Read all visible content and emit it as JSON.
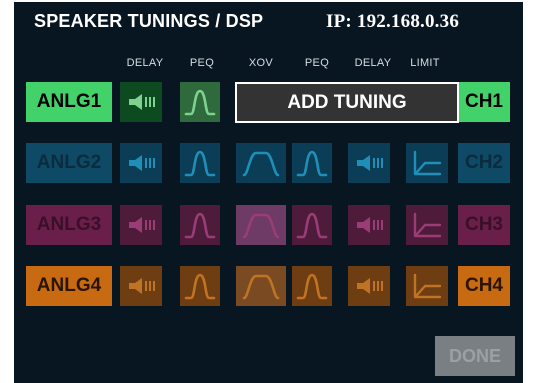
{
  "header": {
    "title": "SPEAKER TUNINGS / DSP",
    "ip_label": "IP: 192.168.0.36"
  },
  "columns": [
    "DELAY",
    "PEQ",
    "XOV",
    "PEQ",
    "DELAY",
    "LIMIT"
  ],
  "icons": {
    "delay": "speaker-delay-icon",
    "peq": "peq-bell-icon",
    "xov": "crossover-icon",
    "limit": "limiter-icon"
  },
  "add_tuning_label": "ADD TUNING",
  "done_label": "DONE",
  "rows": [
    {
      "input": "ANLG1",
      "output": "CH1",
      "colors": {
        "label": "#43d16a",
        "cell": "#0e4a1f",
        "glyph": "#7fd18e",
        "text": "#000000"
      }
    },
    {
      "input": "ANLG2",
      "output": "CH2",
      "colors": {
        "label": "#0e4a66",
        "cell": "#0b3d56",
        "glyph": "#1f8fb8",
        "text": "#0a2c3e"
      }
    },
    {
      "input": "ANLG3",
      "output": "CH3",
      "colors": {
        "label": "#6a1f4a",
        "cell": "#4e1b3a",
        "glyph": "#9a3d77",
        "text": "#3a0f2a"
      }
    },
    {
      "input": "ANLG4",
      "output": "CH4",
      "colors": {
        "label": "#c86a12",
        "cell": "#6f3d12",
        "glyph": "#bf7324",
        "text": "#2a1404"
      }
    }
  ]
}
